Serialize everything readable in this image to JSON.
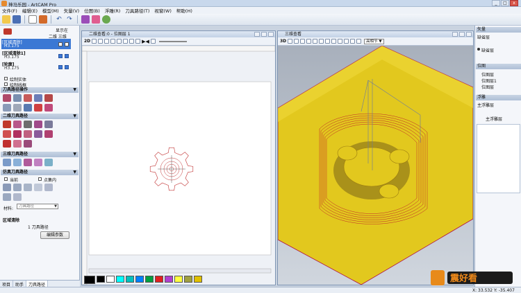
{
  "app": {
    "title": "神马乐园 - ArtCAM Pro",
    "window_buttons": [
      "_",
      "□",
      "x"
    ]
  },
  "menu": [
    "文件(F)",
    "编辑(E)",
    "模型(M)",
    "矢量(V)",
    "位图(B)",
    "浮雕(R)",
    "刀具路径(T)",
    "视窗(W)",
    "帮助(H)"
  ],
  "toolbar_icons": [
    "open-icon",
    "save-icon",
    "new-icon",
    "report-icon",
    "undo-icon",
    "redo-icon",
    "tool-icon",
    "material-icon",
    "help-icon"
  ],
  "left_panel": {
    "show_label": "显示在",
    "view_labels": "二维 三维",
    "toolpaths": [
      {
        "name": "[区域清除]",
        "sub": "H3.175",
        "selected": true
      },
      {
        "name": "[区域清除1]",
        "sub": "H3.175",
        "selected": false
      },
      {
        "name": "[轮廓]",
        "sub": "H3.175",
        "selected": false
      }
    ],
    "draw_options": [
      "绘制实体",
      "绘制线框"
    ],
    "sections": {
      "toolpath_ops": "刀具路径操作",
      "twod": "二维刀具路径",
      "threed": "三维刀具路径",
      "sim": "仿真刀具路径"
    },
    "sim_options": {
      "opt1": "当前",
      "opt2": "点集内"
    },
    "material_label": "材料:",
    "material_value": "刀具路径",
    "summary_title": "区域清除",
    "summary_value": "1 刀具路径",
    "edit_button": "编辑参数"
  },
  "bottom_tabs": [
    "项目",
    "助手",
    "刀具路径"
  ],
  "view2d": {
    "title": "二维查看:0 - 位图层 1",
    "label_2d": "2D"
  },
  "view3d": {
    "title": "三维查看",
    "label_3d": "3D",
    "dropdown": "高相节"
  },
  "right_panel": {
    "sections": [
      {
        "head": "矢量",
        "rows": [
          "缺省层",
          "缺省层"
        ]
      },
      {
        "head": "位图",
        "rows": [
          "位图层",
          "位图层1",
          "位图层"
        ]
      },
      {
        "head": "浮雕",
        "rows": [
          "主浮雕层",
          "主浮雕层"
        ]
      }
    ]
  },
  "status": {
    "coords": "X: 33.532   Y: -35.407"
  },
  "palette_colors": [
    "#000000",
    "#ffffff",
    "#00ffff",
    "#00c0c0",
    "#0080ff",
    "#00a040",
    "#e02020",
    "#b040d0",
    "#ffff40",
    "#a0a040",
    "#e0c000"
  ]
}
